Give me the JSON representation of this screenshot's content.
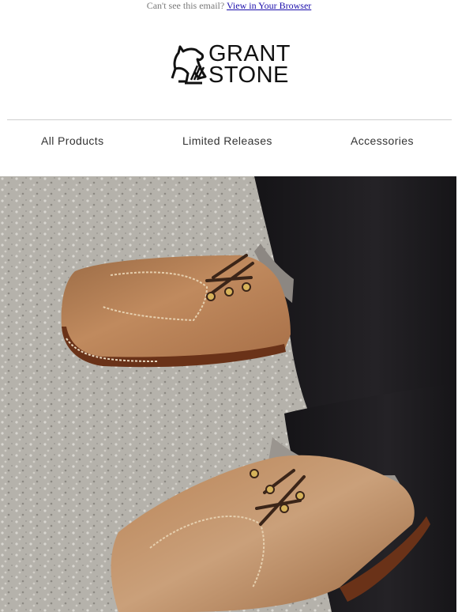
{
  "preheader": {
    "text": "Can't see this email?",
    "link_label": "View in Your Browser"
  },
  "brand": {
    "line1": "GRANT",
    "line2": "STONE",
    "logo_icon": "horse-head-icon"
  },
  "nav": {
    "items": [
      "All Products",
      "Limited Releases",
      "Accessories"
    ]
  },
  "hero": {
    "icon": "boots-photo",
    "colors": {
      "ground": "#b8b5ae",
      "leather": "#b57a4a",
      "sole": "#5a2a14",
      "denim": "#1b1a1d"
    }
  }
}
